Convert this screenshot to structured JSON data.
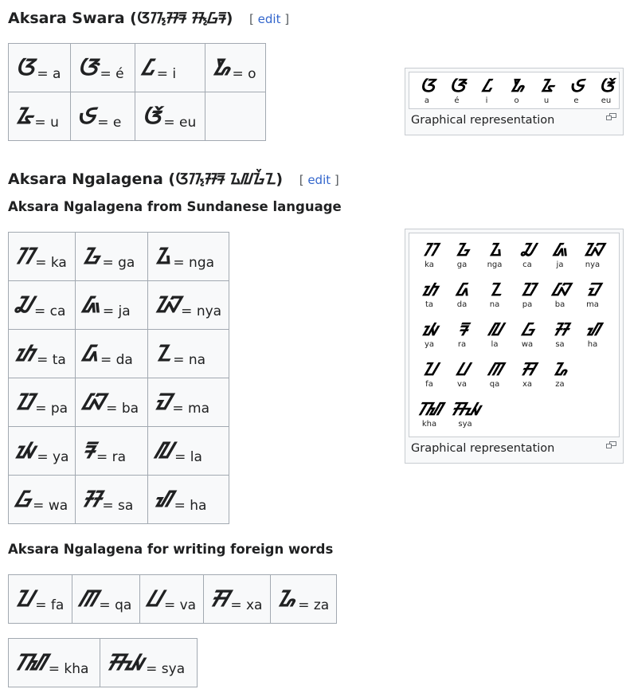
{
  "swara": {
    "heading": "Aksara Swara",
    "heading_script": "(ᮃᮊ᮪ᮞᮛ ᮞ᮪ᮝᮛ)",
    "edit_label": "edit",
    "rows": [
      [
        {
          "glyph": "ᮃ",
          "latin": "a"
        },
        {
          "glyph": "ᮆ",
          "latin": "é"
        },
        {
          "glyph": "ᮄ",
          "latin": "i"
        },
        {
          "glyph": "ᮇ",
          "latin": "o"
        }
      ],
      [
        {
          "glyph": "ᮅ",
          "latin": "u"
        },
        {
          "glyph": "ᮈ",
          "latin": "e"
        },
        {
          "glyph": "ᮉ",
          "latin": "eu"
        }
      ]
    ],
    "figure": {
      "glyphs": [
        {
          "glyph": "ᮃ",
          "latin": "a"
        },
        {
          "glyph": "ᮆ",
          "latin": "é"
        },
        {
          "glyph": "ᮄ",
          "latin": "i"
        },
        {
          "glyph": "ᮇ",
          "latin": "o"
        },
        {
          "glyph": "ᮅ",
          "latin": "u"
        },
        {
          "glyph": "ᮈ",
          "latin": "e"
        },
        {
          "glyph": "ᮉ",
          "latin": "eu"
        }
      ],
      "caption": "Graphical representation"
    }
  },
  "ngalagena": {
    "heading": "Aksara Ngalagena",
    "heading_script": "(ᮃᮊ᮪ᮞᮛ ᮍᮜᮌᮨᮔ)",
    "edit_label": "edit",
    "sub1": "Aksara Ngalagena from Sundanese language",
    "rows": [
      [
        {
          "glyph": "ᮊ",
          "latin": "ka"
        },
        {
          "glyph": "ᮌ",
          "latin": "ga"
        },
        {
          "glyph": "ᮍ",
          "latin": "nga"
        }
      ],
      [
        {
          "glyph": "ᮎ",
          "latin": "ca"
        },
        {
          "glyph": "ᮏ",
          "latin": "ja"
        },
        {
          "glyph": "ᮑ",
          "latin": "nya"
        }
      ],
      [
        {
          "glyph": "ᮒ",
          "latin": "ta"
        },
        {
          "glyph": "ᮓ",
          "latin": "da"
        },
        {
          "glyph": "ᮔ",
          "latin": "na"
        }
      ],
      [
        {
          "glyph": "ᮕ",
          "latin": "pa"
        },
        {
          "glyph": "ᮘ",
          "latin": "ba"
        },
        {
          "glyph": "ᮙ",
          "latin": "ma"
        }
      ],
      [
        {
          "glyph": "ᮚ",
          "latin": "ya"
        },
        {
          "glyph": "ᮛ",
          "latin": "ra"
        },
        {
          "glyph": "ᮜ",
          "latin": "la"
        }
      ],
      [
        {
          "glyph": "ᮝ",
          "latin": "wa"
        },
        {
          "glyph": "ᮞ",
          "latin": "sa"
        },
        {
          "glyph": "ᮠ",
          "latin": "ha"
        }
      ]
    ],
    "sub2": "Aksara Ngalagena for writing foreign words",
    "foreign_row1": [
      {
        "glyph": "ᮖ",
        "latin": "fa"
      },
      {
        "glyph": "ᮋ",
        "latin": "qa"
      },
      {
        "glyph": "ᮗ",
        "latin": "va"
      },
      {
        "glyph": "ᮟ",
        "latin": "xa"
      },
      {
        "glyph": "ᮐ",
        "latin": "za"
      }
    ],
    "foreign_row2": [
      {
        "glyph": "ᮮ",
        "latin": "kha"
      },
      {
        "glyph": "ᮯ",
        "latin": "sya"
      }
    ],
    "figure": {
      "rows": [
        [
          {
            "glyph": "ᮊ",
            "latin": "ka"
          },
          {
            "glyph": "ᮌ",
            "latin": "ga"
          },
          {
            "glyph": "ᮍ",
            "latin": "nga"
          },
          {
            "glyph": "ᮎ",
            "latin": "ca"
          },
          {
            "glyph": "ᮏ",
            "latin": "ja"
          },
          {
            "glyph": "ᮑ",
            "latin": "nya"
          }
        ],
        [
          {
            "glyph": "ᮒ",
            "latin": "ta"
          },
          {
            "glyph": "ᮓ",
            "latin": "da"
          },
          {
            "glyph": "ᮔ",
            "latin": "na"
          },
          {
            "glyph": "ᮕ",
            "latin": "pa"
          },
          {
            "glyph": "ᮘ",
            "latin": "ba"
          },
          {
            "glyph": "ᮙ",
            "latin": "ma"
          }
        ],
        [
          {
            "glyph": "ᮚ",
            "latin": "ya"
          },
          {
            "glyph": "ᮛ",
            "latin": "ra"
          },
          {
            "glyph": "ᮜ",
            "latin": "la"
          },
          {
            "glyph": "ᮝ",
            "latin": "wa"
          },
          {
            "glyph": "ᮞ",
            "latin": "sa"
          },
          {
            "glyph": "ᮠ",
            "latin": "ha"
          }
        ],
        [
          {
            "glyph": "ᮖ",
            "latin": "fa"
          },
          {
            "glyph": "ᮗ",
            "latin": "va"
          },
          {
            "glyph": "ᮋ",
            "latin": "qa"
          },
          {
            "glyph": "ᮟ",
            "latin": "xa"
          },
          {
            "glyph": "ᮐ",
            "latin": "za"
          }
        ],
        [
          {
            "glyph": "ᮮ",
            "latin": "kha"
          },
          {
            "glyph": "ᮯ",
            "latin": "sya"
          }
        ]
      ],
      "caption": "Graphical representation"
    }
  }
}
